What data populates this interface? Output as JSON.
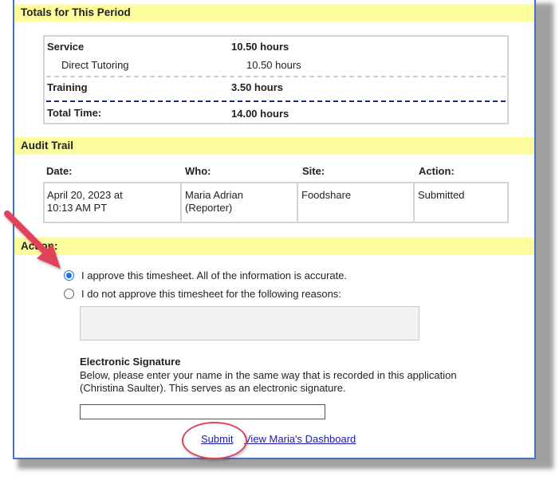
{
  "totals": {
    "title": "Totals for This Period",
    "rows": [
      {
        "label": "Service",
        "value": "10.50 hours"
      },
      {
        "label": "Direct Tutoring",
        "value": "10.50 hours"
      },
      {
        "label": "Training",
        "value": "3.50 hours"
      },
      {
        "label": "Total Time:",
        "value": "14.00 hours"
      }
    ]
  },
  "audit": {
    "title": "Audit Trail",
    "headers": [
      "Date:",
      "Who:",
      "Site:",
      "Action:"
    ],
    "row": {
      "date_line1": "April 20, 2023 at",
      "date_line2": "10:13 AM PT",
      "who_line1": "Maria Adrian",
      "who_line2": "(Reporter)",
      "site": "Foodshare",
      "action": "Submitted"
    }
  },
  "action": {
    "title": "Action:",
    "approve_label": "I approve this timesheet. All of the information is accurate.",
    "reject_label": "I do not approve this timesheet for the following reasons:",
    "approve_selected": true,
    "reasons_value": ""
  },
  "signature": {
    "heading": "Electronic Signature",
    "text_line1": "Below, please enter your name in the same way that is recorded in this application",
    "text_line2": "(Christina Saulter). This serves as an electronic signature.",
    "value": ""
  },
  "links": {
    "submit": "Submit",
    "dashboard": "View Maria's Dashboard"
  },
  "annotation_color": "#e0435a"
}
